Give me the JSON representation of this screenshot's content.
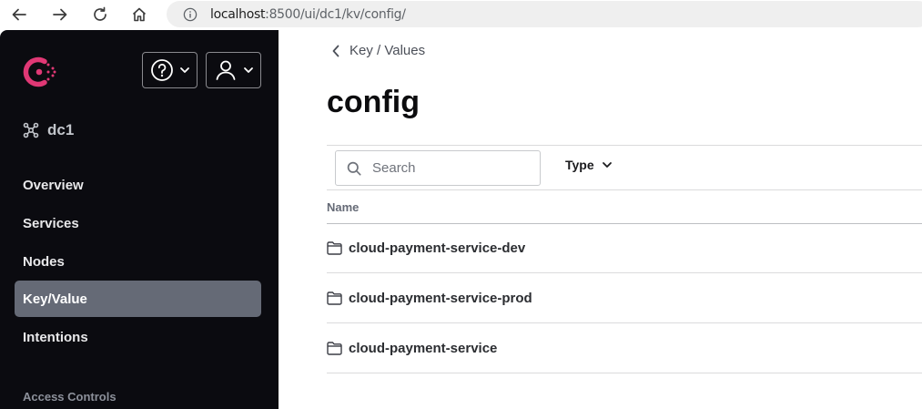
{
  "browser": {
    "url_host": "localhost",
    "url_rest": ":8500/ui/dc1/kv/config/"
  },
  "sidebar": {
    "datacenter": "dc1",
    "items": [
      {
        "label": "Overview",
        "active": false
      },
      {
        "label": "Services",
        "active": false
      },
      {
        "label": "Nodes",
        "active": false
      },
      {
        "label": "Key/Value",
        "active": true
      },
      {
        "label": "Intentions",
        "active": false
      }
    ],
    "section_label": "Access Controls"
  },
  "main": {
    "breadcrumb": "Key / Values",
    "title": "config",
    "search_placeholder": "Search",
    "type_filter": "Type",
    "column_name": "Name",
    "rows": [
      {
        "name": "cloud-payment-service-dev",
        "icon": "folder-icon"
      },
      {
        "name": "cloud-payment-service-prod",
        "icon": "folder-icon"
      },
      {
        "name": "cloud-payment-service",
        "icon": "folder-icon"
      }
    ]
  },
  "colors": {
    "sidebar_bg": "#0b0b10",
    "active_item_bg": "#656a76",
    "brand": "#e03875"
  }
}
